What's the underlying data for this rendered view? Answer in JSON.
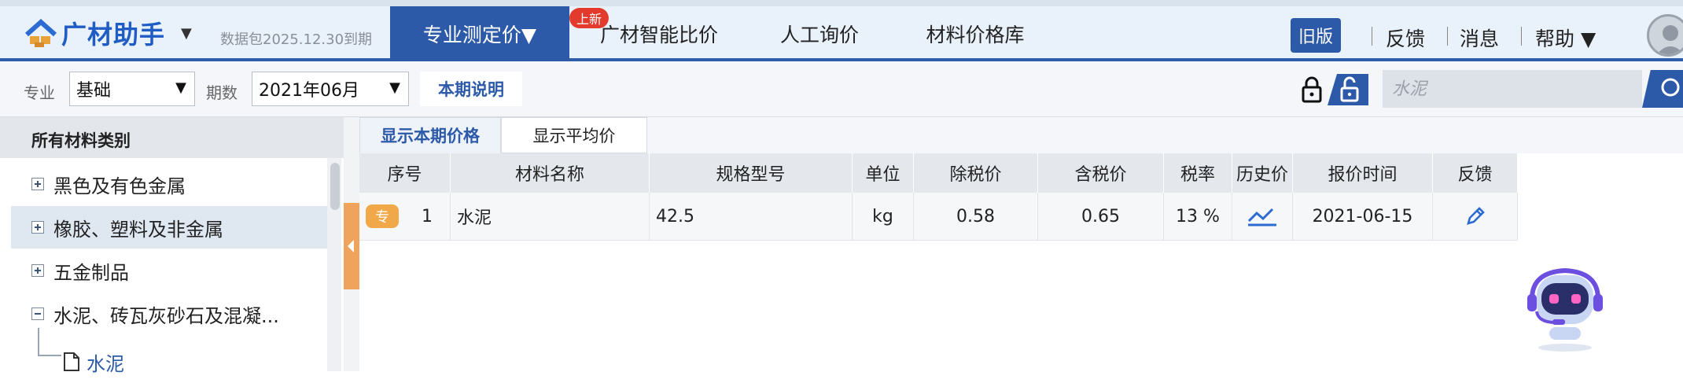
{
  "app": {
    "logo_text": "广材助手",
    "package_expiry": "数据包2025.12.30到期"
  },
  "nav": {
    "items": [
      "专业测定价▼",
      "广材智能比价",
      "人工询价",
      "材料价格库"
    ],
    "new_badge": "上新"
  },
  "top_right": {
    "old_version": "旧版",
    "feedback": "反馈",
    "messages": "消息",
    "help": "帮助 ▼"
  },
  "filters": {
    "specialty_label": "专业",
    "specialty_value": "基础",
    "period_label": "期数",
    "period_value": "2021年06月",
    "period_note": "本期说明"
  },
  "search": {
    "placeholder": "水泥"
  },
  "sidebar": {
    "title": "所有材料类别",
    "items": [
      {
        "label": "黑色及有色金属"
      },
      {
        "label": "橡胶、塑料及非金属"
      },
      {
        "label": "五金制品"
      },
      {
        "label": "水泥、砖瓦灰砂石及混凝..."
      },
      {
        "label": "水泥"
      }
    ]
  },
  "tabs": [
    "显示本期价格",
    "显示平均价"
  ],
  "table": {
    "columns": [
      "序号",
      "材料名称",
      "规格型号",
      "单位",
      "除税价",
      "含税价",
      "税率",
      "历史价",
      "报价时间",
      "反馈"
    ],
    "rows": [
      {
        "tag": "专",
        "index": "1",
        "name": "水泥",
        "spec": "42.5",
        "unit": "kg",
        "price_ex_tax": "0.58",
        "price_inc_tax": "0.65",
        "tax_rate": "13 %",
        "date": "2021-06-15"
      }
    ]
  },
  "colors": {
    "primary": "#2c5aa8",
    "accent_orange": "#f0a35c",
    "badge_red": "#e23b2e"
  },
  "icons": [
    "logo-icon",
    "lock-icon",
    "unlock-icon",
    "search-icon",
    "history-chart-icon",
    "edit-pencil-icon",
    "robot-assistant-icon",
    "file-icon"
  ]
}
